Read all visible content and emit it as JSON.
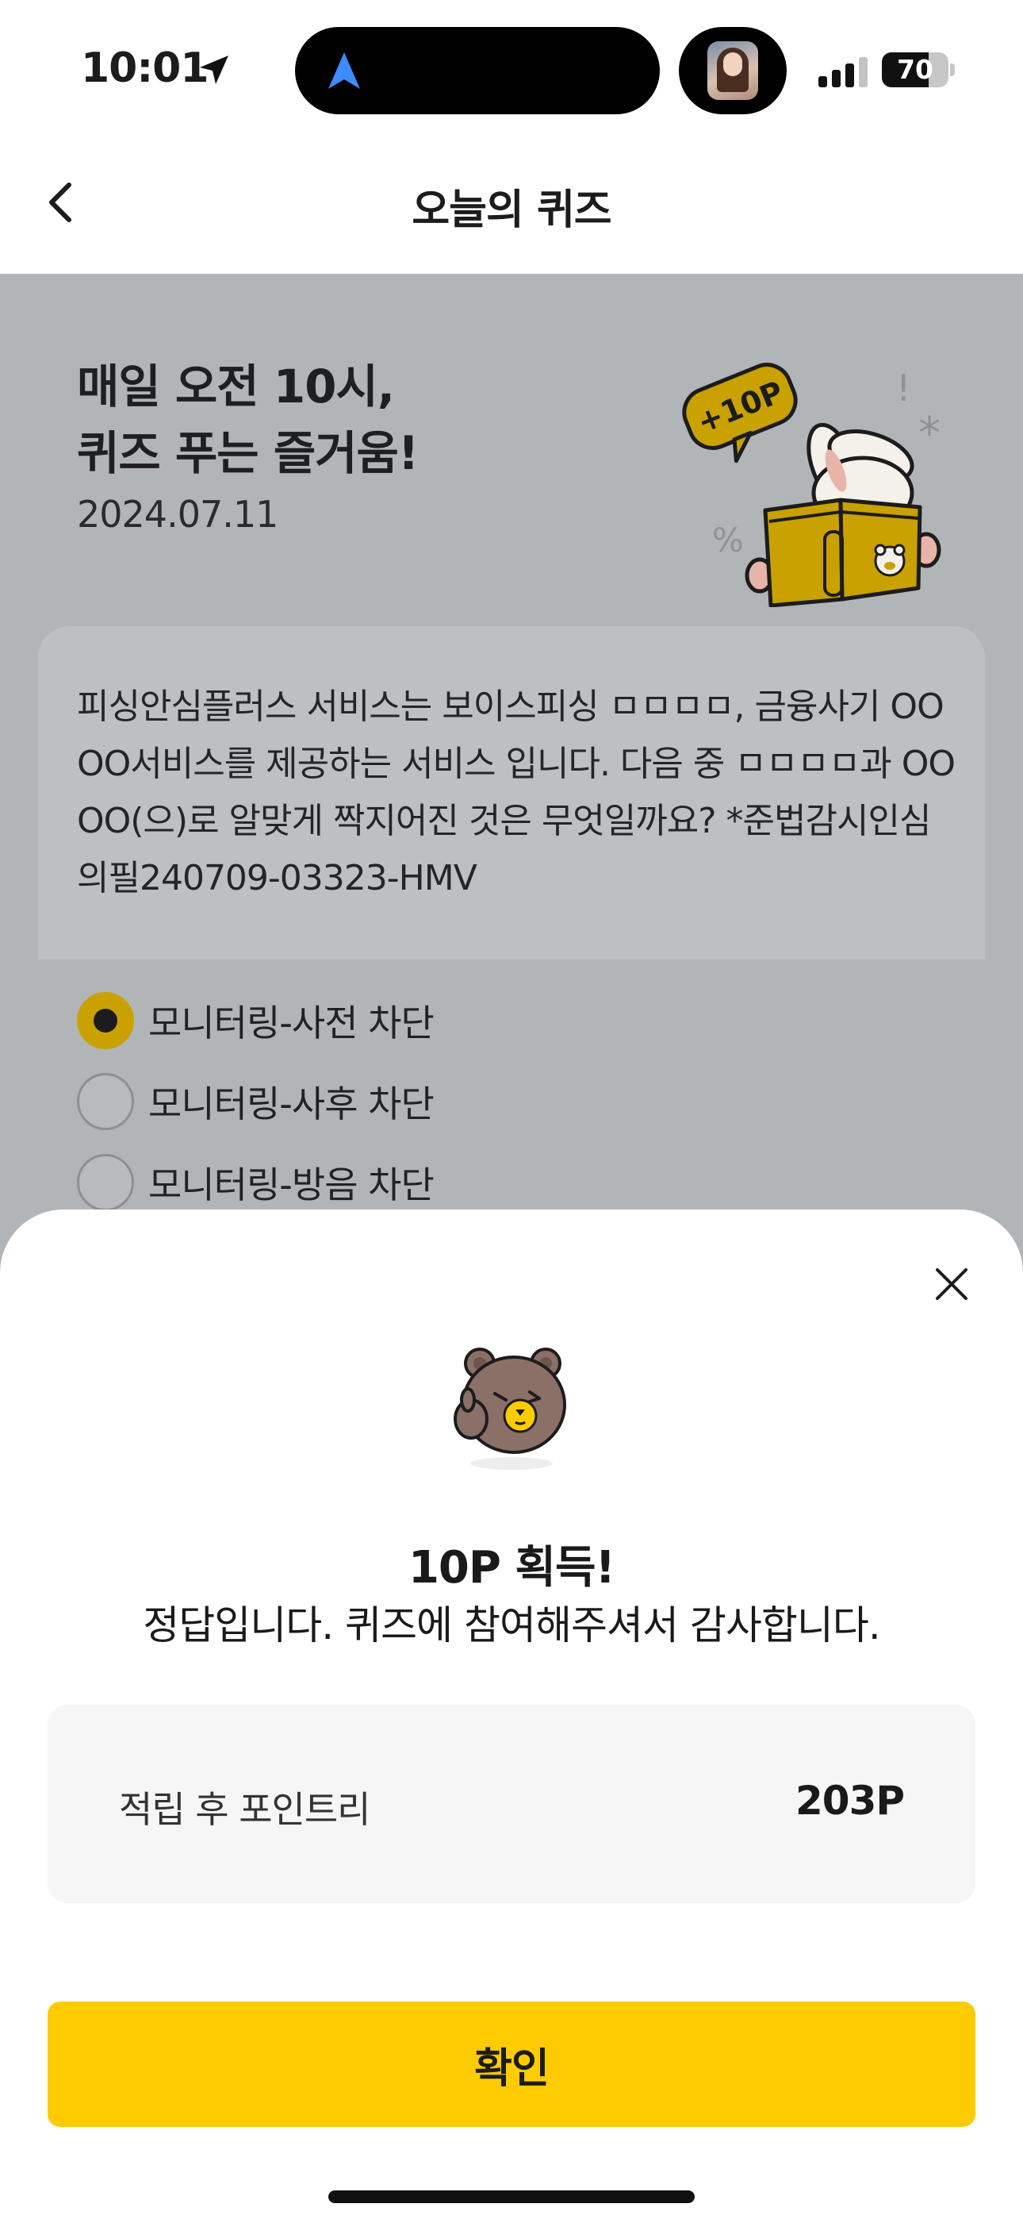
{
  "status_bar": {
    "time": "10:01",
    "battery_level": "70",
    "battery_fraction": 0.7,
    "signal_bars_active": 3,
    "signal_bars_total": 4
  },
  "header": {
    "title": "오늘의 퀴즈"
  },
  "banner": {
    "title_line1": "매일 오전 10시,",
    "title_line2": "퀴즈 푸는 즐거움!",
    "date": "2024.07.11",
    "badge": "+10P"
  },
  "quiz": {
    "question": "피싱안심플러스 서비스는 보이스피싱 ㅁㅁㅁㅁ, 금융사기 OO OO서비스를 제공하는 서비스 입니다. 다음 중 ㅁㅁㅁㅁ과 OO OO(으)로 알맞게 짝지어진 것은 무엇일까요? *준법감시인심의필240709-03323-HMV",
    "options": [
      {
        "label": "모니터링-사전 차단",
        "selected": true
      },
      {
        "label": "모니터링-사후 차단",
        "selected": false
      },
      {
        "label": "모니터링-방음 차단",
        "selected": false
      }
    ]
  },
  "result_sheet": {
    "title": "10P 획득!",
    "message": "정답입니다. 퀴즈에 참여해주셔서 감사합니다.",
    "points_label": "적립 후 포인트리",
    "points_value": "203P",
    "confirm_label": "확인"
  },
  "icons": {
    "back": "chevron-left-icon",
    "close": "close-icon",
    "location": "location-arrow-icon",
    "navigation": "navigation-arrow-icon"
  },
  "colors": {
    "accent": "#FDCB00",
    "dim_overlay": "#B2B5B8",
    "selected_radio": "#C9A100"
  }
}
